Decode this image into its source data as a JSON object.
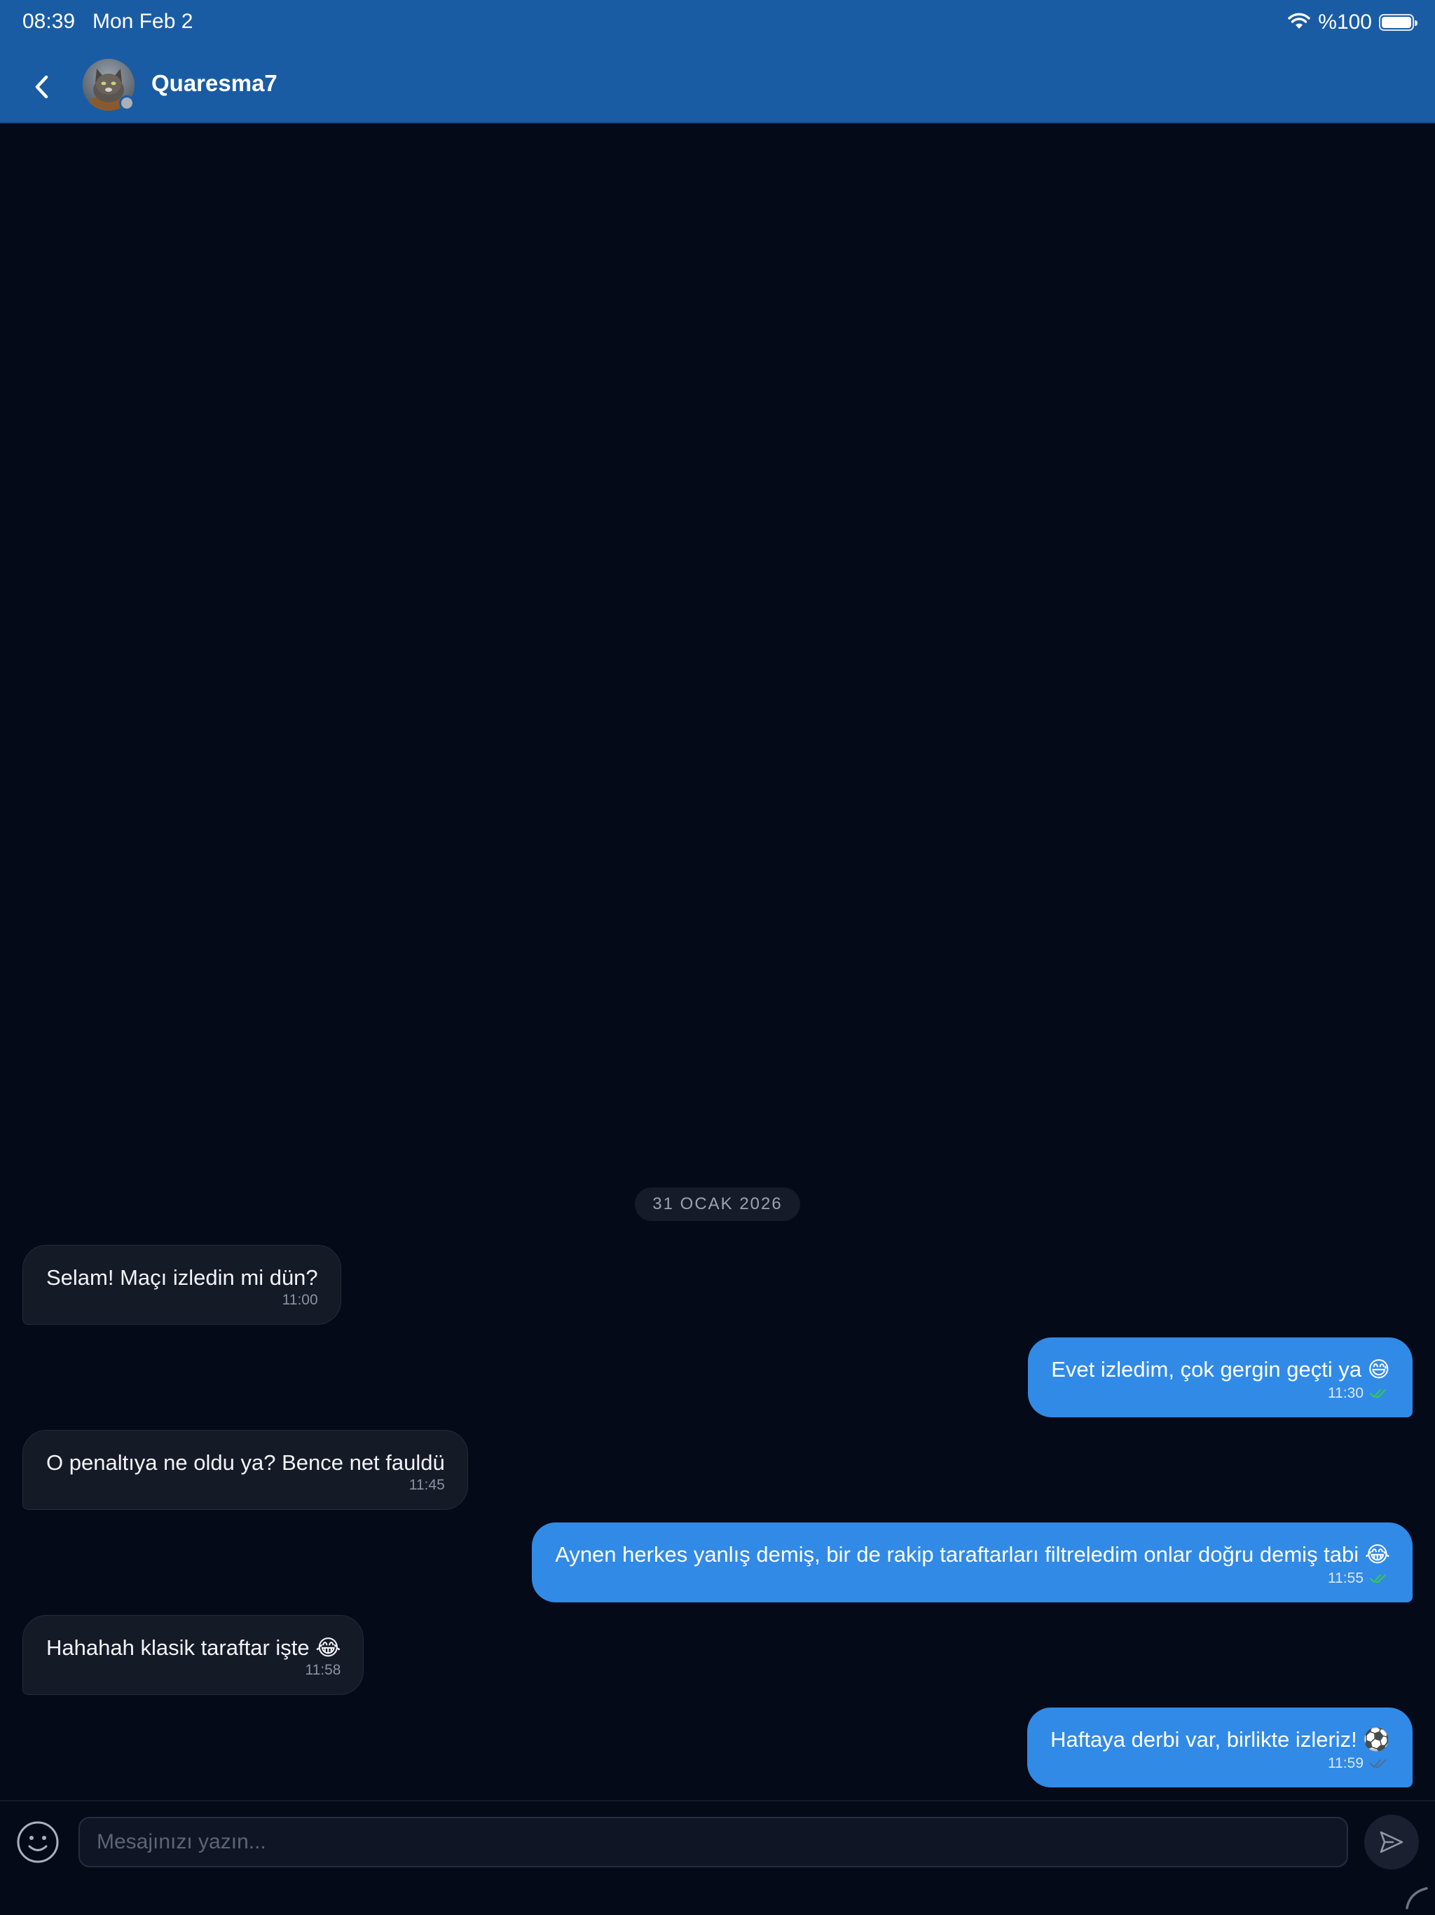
{
  "status_bar": {
    "time": "08:39",
    "date": "Mon Feb 2",
    "battery_label": "%100",
    "battery_level": 1.0
  },
  "header": {
    "contact_name": "Quaresma7",
    "back_icon": "chevron-left-icon",
    "avatar": "cat-photo-avatar",
    "presence": "offline"
  },
  "chat": {
    "date_separator": "31 OCAK 2026",
    "messages": [
      {
        "direction": "incoming",
        "text": "Selam! Maçı izledin mi dün?",
        "time": "11:00"
      },
      {
        "direction": "outgoing",
        "text": "Evet izledim, çok gergin geçti ya 😅",
        "time": "11:30",
        "status": "read"
      },
      {
        "direction": "incoming",
        "text": "O penaltıya ne oldu ya? Bence net fauldü",
        "time": "11:45"
      },
      {
        "direction": "outgoing",
        "text": "Aynen herkes yanlış demiş, bir de rakip taraftarları filtreledim onlar doğru demiş tabi 😂",
        "time": "11:55",
        "status": "read"
      },
      {
        "direction": "incoming",
        "text": "Hahahah klasik taraftar işte 😂",
        "time": "11:58"
      },
      {
        "direction": "outgoing",
        "text": "Haftaya derbi var, birlikte izleriz! ⚽",
        "time": "11:59",
        "status": "delivered"
      }
    ]
  },
  "composer": {
    "placeholder": "Mesajınızı yazın...",
    "value": "",
    "emoji_icon": "smiley-icon",
    "send_icon": "paper-plane-icon"
  },
  "colors": {
    "header_bg": "#1a5ca4",
    "background": "#050a19",
    "incoming_bubble": "#151a27",
    "outgoing_bubble": "#318ae6",
    "read_check": "#34c759",
    "delivered_check": "#4a6f9e"
  }
}
